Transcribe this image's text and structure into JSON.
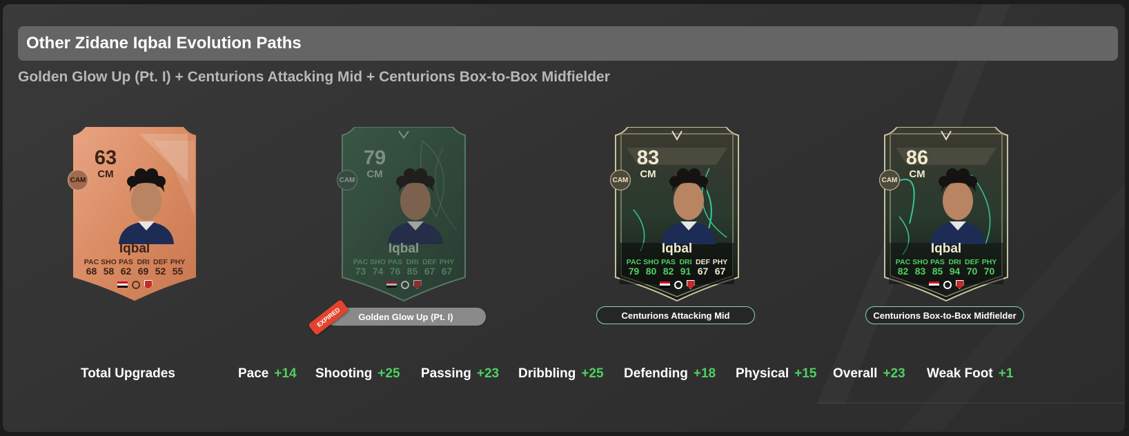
{
  "header": {
    "title": "Other Zidane Iqbal Evolution Paths",
    "subtitle": "Golden Glow Up (Pt. I) + Centurions Attacking Mid + Centurions Box-to-Box Midfielder"
  },
  "cards": [
    {
      "rating": "63",
      "position": "CM",
      "alt_position": "CAM",
      "name": "Iqbal",
      "stat_labels": [
        "PAC",
        "SHO",
        "PAS",
        "DRI",
        "DEF",
        "PHY"
      ],
      "stats": [
        "68",
        "58",
        "62",
        "69",
        "52",
        "55"
      ],
      "style": "bronze"
    },
    {
      "rating": "79",
      "position": "CM",
      "alt_position": "CAM",
      "name": "Iqbal",
      "stat_labels": [
        "PAC",
        "SHO",
        "PAS",
        "DRI",
        "DEF",
        "PHY"
      ],
      "stats": [
        "73",
        "74",
        "76",
        "85",
        "67",
        "67"
      ],
      "style": "green-faded",
      "path_label": "Golden Glow Up (Pt. I)",
      "badge": "EXPIRED"
    },
    {
      "rating": "83",
      "position": "CM",
      "alt_position": "CAM",
      "name": "Iqbal",
      "stat_labels": [
        "PAC",
        "SHO",
        "PAS",
        "DRI",
        "DEF",
        "PHY"
      ],
      "stats": [
        "79",
        "80",
        "82",
        "91",
        "67",
        "67"
      ],
      "style": "centurion",
      "path_label": "Centurions Attacking Mid"
    },
    {
      "rating": "86",
      "position": "CM",
      "alt_position": "CAM",
      "name": "Iqbal",
      "stat_labels": [
        "PAC",
        "SHO",
        "PAS",
        "DRI",
        "DEF",
        "PHY"
      ],
      "stats": [
        "82",
        "83",
        "85",
        "94",
        "70",
        "70"
      ],
      "style": "centurion",
      "path_label": "Centurions Box-to-Box Midfielder"
    }
  ],
  "upgrades": {
    "title": "Total Upgrades",
    "items": [
      {
        "name": "Pace",
        "value": "+14"
      },
      {
        "name": "Shooting",
        "value": "+25"
      },
      {
        "name": "Passing",
        "value": "+23"
      },
      {
        "name": "Dribbling",
        "value": "+25"
      },
      {
        "name": "Defending",
        "value": "+18"
      },
      {
        "name": "Physical",
        "value": "+15"
      },
      {
        "name": "Overall",
        "value": "+23"
      },
      {
        "name": "Weak Foot",
        "value": "+1"
      }
    ]
  },
  "colors": {
    "positive": "#4fd160",
    "bronze": "#d9906a",
    "green_card": "#2f4d3b",
    "centurion_dark": "#1f2a22",
    "accent_outline": "#7fd7c5",
    "expired": "#e2432f"
  }
}
